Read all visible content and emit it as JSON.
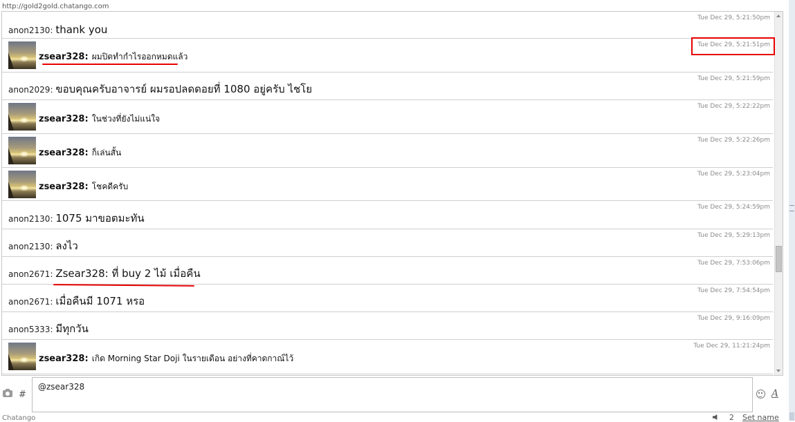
{
  "url": "http://gold2gold.chatango.com",
  "messages": [
    {
      "kind": "anon",
      "name": "anon2130",
      "text": "thank you",
      "ts": "Tue Dec 29, 5:21:50pm"
    },
    {
      "kind": "user",
      "name": "zsear328:",
      "text": "ผมปิดทำกำไรออกหมดแล้ว",
      "ts": "Tue Dec 29, 5:21:51pm"
    },
    {
      "kind": "anon",
      "name": "anon2029",
      "text": "ขอบคุณครับอาจารย์ ผมรอปลดดอยที่ 1080 อยู่ครับ ไชโย",
      "ts": "Tue Dec 29, 5:21:59pm"
    },
    {
      "kind": "user",
      "name": "zsear328:",
      "text": "ในช่วงที่ยังไม่แน่ใจ",
      "ts": "Tue Dec 29, 5:22:22pm"
    },
    {
      "kind": "user",
      "name": "zsear328:",
      "text": "ก็เล่นสั้น",
      "ts": "Tue Dec 29, 5:22:26pm"
    },
    {
      "kind": "user",
      "name": "zsear328:",
      "text": "โชคดีครับ",
      "ts": "Tue Dec 29, 5:23:04pm"
    },
    {
      "kind": "anon",
      "name": "anon2130",
      "text": "1075 มาขอตมะทัน",
      "ts": "Tue Dec 29, 5:24:59pm"
    },
    {
      "kind": "anon",
      "name": "anon2130",
      "text": "ลงไว",
      "ts": "Tue Dec 29, 5:29:13pm"
    },
    {
      "kind": "anon",
      "name": "anon2671",
      "text": "Zsear328: ที่ buy 2 ไม้ เมื่อคืน",
      "ts": "Tue Dec 29, 7:53:06pm"
    },
    {
      "kind": "anon",
      "name": "anon2671",
      "text": "เมื่อคืนมี 1071 หรอ",
      "ts": "Tue Dec 29, 7:54:54pm"
    },
    {
      "kind": "anon",
      "name": "anon5333",
      "text": "มีทุกวัน",
      "ts": "Tue Dec 29, 9:16:09pm"
    },
    {
      "kind": "user",
      "name": "zsear328:",
      "text": "เกิด Morning Star Doji ในรายเดือน อย่างที่คาดกาณ์ไว้",
      "ts": "Tue Dec 29, 11:21:24pm"
    }
  ],
  "input": {
    "value": "@zsear328"
  },
  "icons": {
    "camera": "camera-icon",
    "hash": "#",
    "smiley": "smiley-icon",
    "font": "A",
    "speaker": "speaker-icon"
  },
  "footer": {
    "brand": "Chatango",
    "user_count": "2",
    "set_name": "Set name"
  },
  "colors": {
    "annotation": "#e60000",
    "border": "#cfcfcf",
    "timestamp": "#8a8a8a"
  }
}
